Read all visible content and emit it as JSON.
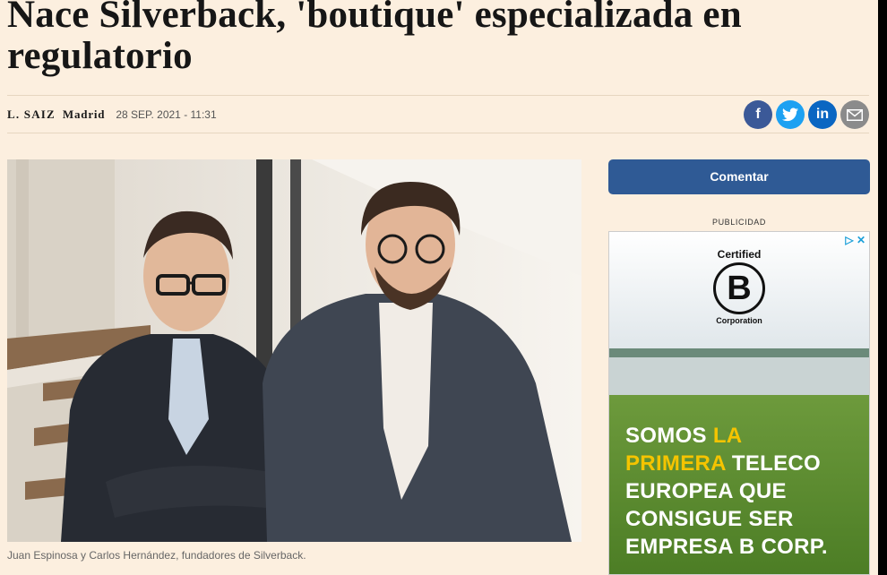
{
  "article": {
    "headline": "Nace Silverback, 'boutique' especializada en regulatorio",
    "author": "L. SAIZ",
    "city": "Madrid",
    "date": "28 SEP. 2021 - 11:31",
    "caption": "Juan Espinosa y Carlos Hernández, fundadores de Silverback."
  },
  "share": {
    "facebook": "f",
    "twitter": "twitter-icon",
    "linkedin": "in",
    "mail": "mail-icon"
  },
  "sidebar": {
    "comment_label": "Comentar",
    "ad_label": "PUBLICIDAD"
  },
  "ad": {
    "certified": "Certified",
    "b_letter": "B",
    "corporation": "Corporation",
    "line1_white": "SOMOS",
    "line1_yellow": "LA",
    "line2_yellow": "PRIMERA",
    "line2_white": "TELECO",
    "line3": "EUROPEA QUE",
    "line4": "CONSIGUE SER",
    "line5": "EMPRESA B CORP."
  },
  "colors": {
    "background": "#fcefdf",
    "comment_button": "#2f5a95",
    "facebook": "#3b5998",
    "twitter": "#1da1f2",
    "linkedin": "#0a66c2",
    "ad_yellow": "#f5c400"
  }
}
